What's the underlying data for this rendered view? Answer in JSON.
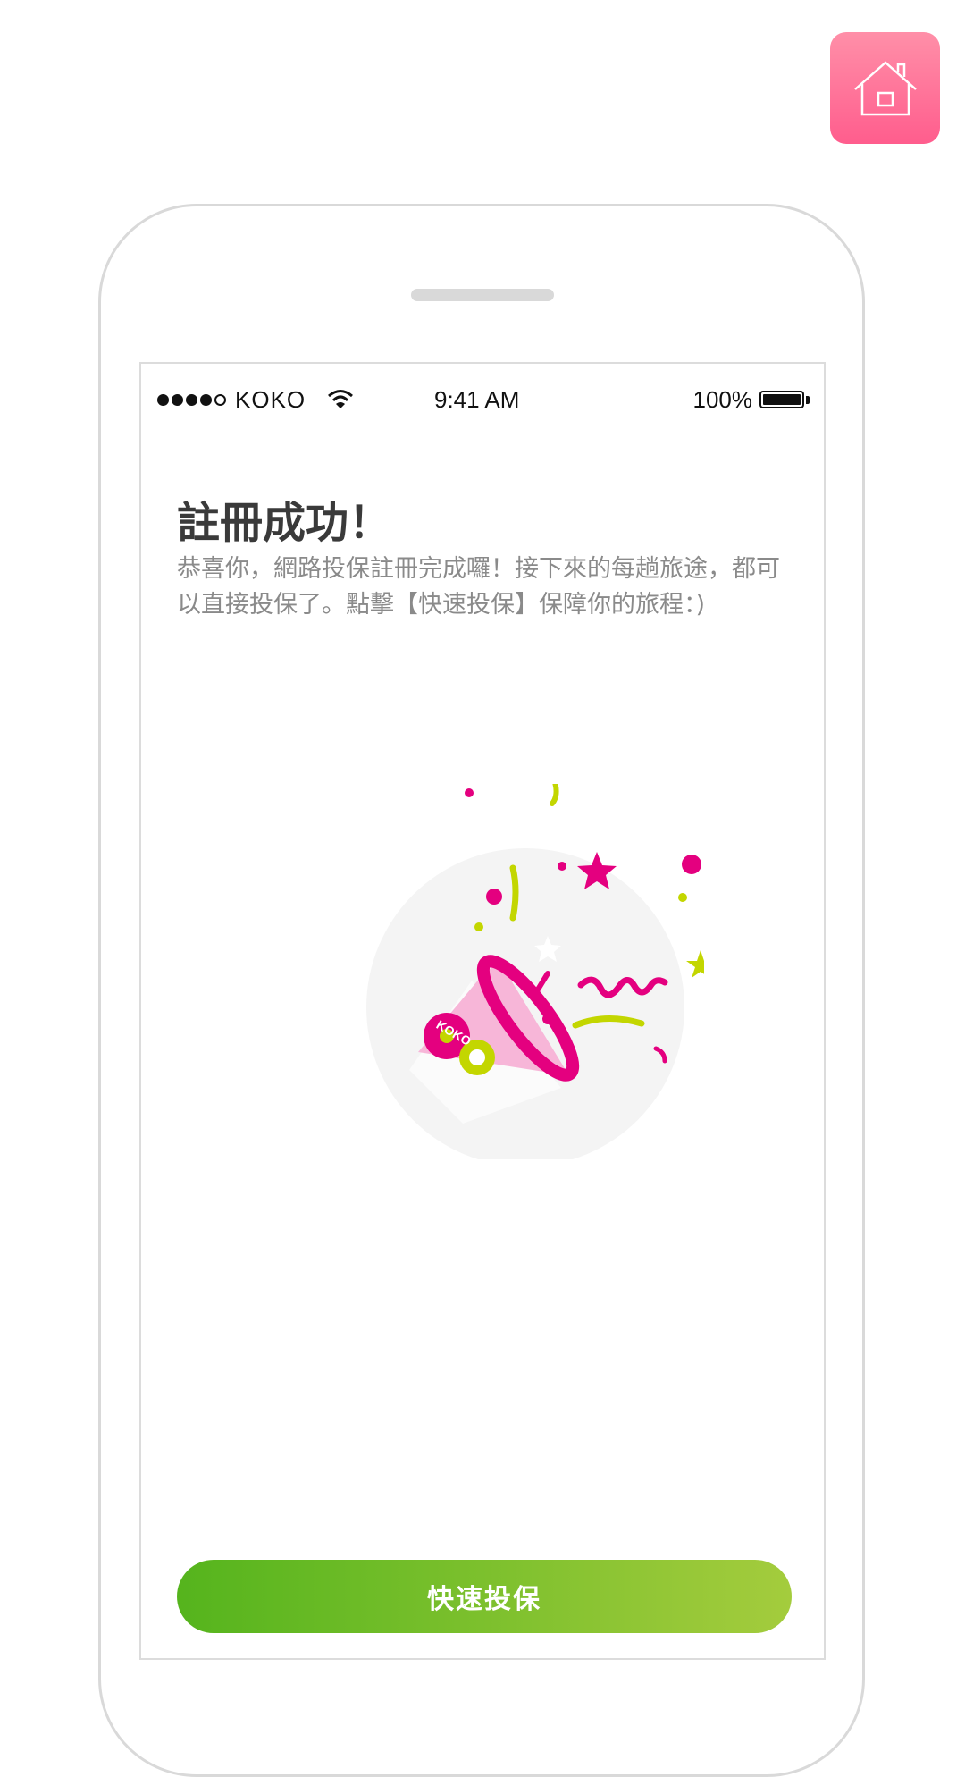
{
  "status_bar": {
    "carrier": "KOKO",
    "time": "9:41 AM",
    "battery": "100%"
  },
  "content": {
    "title": "註冊成功！",
    "message": "恭喜你，網路投保註冊完成囉！接下來的每趟旅途，都可以直接投保了。點擊【快速投保】保障你的旅程：)"
  },
  "illustration": {
    "icon": "party-popper-icon",
    "logo_text": "KOKO"
  },
  "actions": {
    "quick_insure_label": "快速投保"
  },
  "colors": {
    "accent_pink": "#e4007f",
    "accent_lime": "#c3d600",
    "button_start": "#55b41d",
    "button_end": "#a4cc3d",
    "home_button": "#ff6f96"
  }
}
